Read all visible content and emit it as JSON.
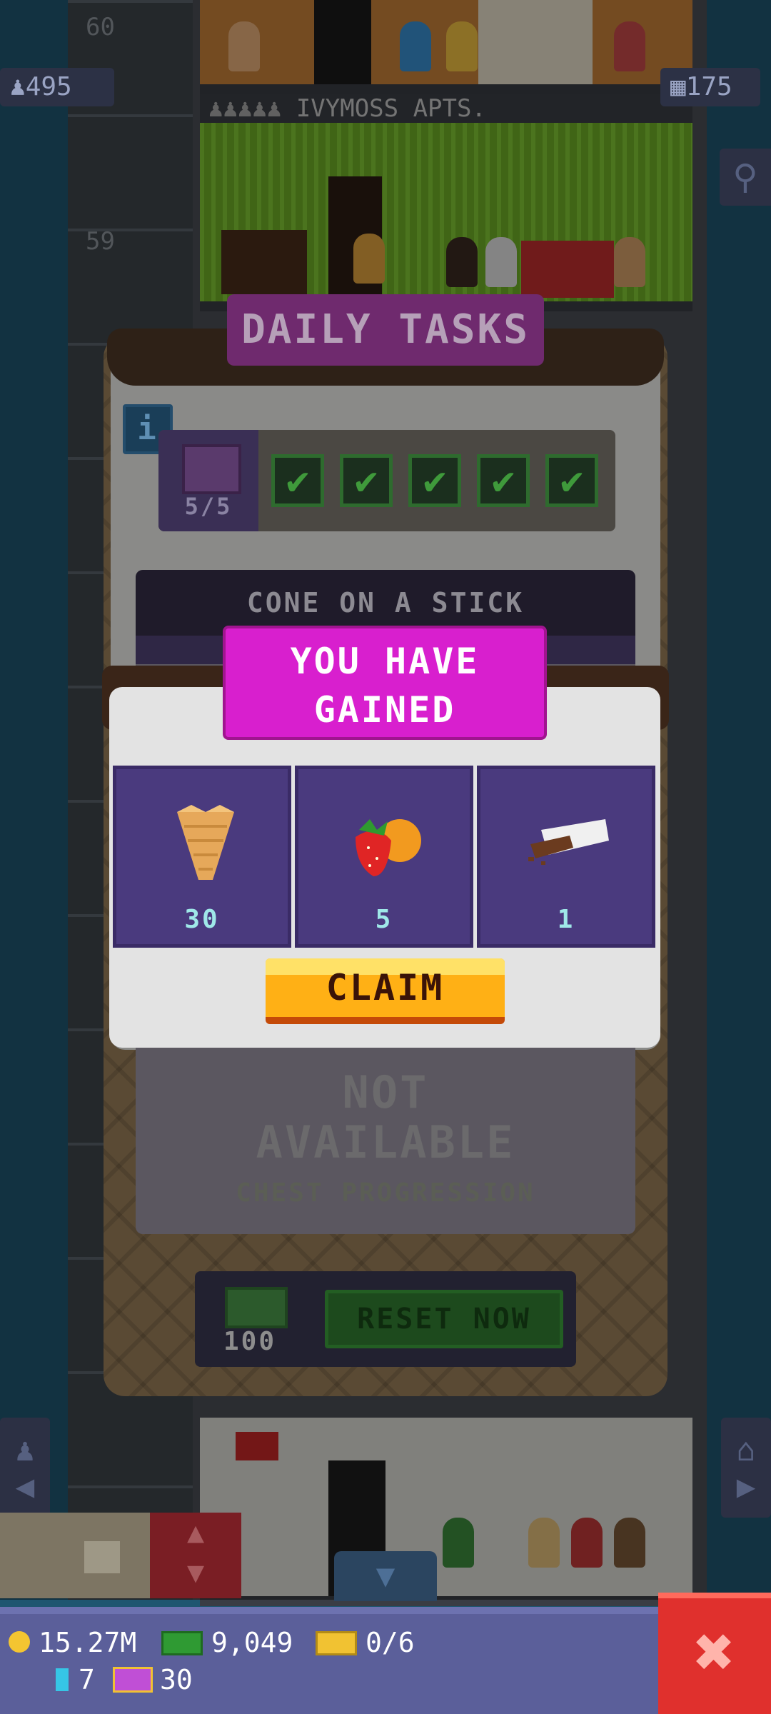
{
  "hud_top": {
    "population": "495",
    "floors": "175",
    "floor_numbers": [
      "60",
      "59"
    ],
    "floor_names": [
      "IVYMOSS APTS."
    ]
  },
  "daily_tasks": {
    "title": "DAILY TASKS",
    "info_label": "i",
    "progress": "5/5",
    "completed_checks": 5,
    "task_name": "CONE ON A STICK",
    "status": "NOT AVAILABLE",
    "status_line1": "NOT",
    "status_line2": "AVAILABLE",
    "chest_text": "CHEST PROGRESSION",
    "reset_cost": "100",
    "reset_label": "RESET NOW"
  },
  "reward_popup": {
    "title_line1": "YOU HAVE",
    "title_line2": "GAINED",
    "rewards": [
      {
        "icon": "waffle-cone-icon",
        "amount": "30"
      },
      {
        "icon": "strawberry-orange-fruit-icon",
        "amount": "5"
      },
      {
        "icon": "chocolate-bar-icon",
        "amount": "1"
      }
    ],
    "claim_label": "CLAIM"
  },
  "bottom_hud": {
    "coins": "15.27M",
    "bux": "9,049",
    "tickets": "0/6",
    "keys": "7",
    "vip": "30",
    "close_label": "✖"
  },
  "colors": {
    "popup_magenta": "#d81fce",
    "claim_yellow": "#ffb015",
    "close_red": "#e0302d",
    "reward_purple": "#4a3a7e",
    "hud_blue": "#5b5f9a"
  }
}
